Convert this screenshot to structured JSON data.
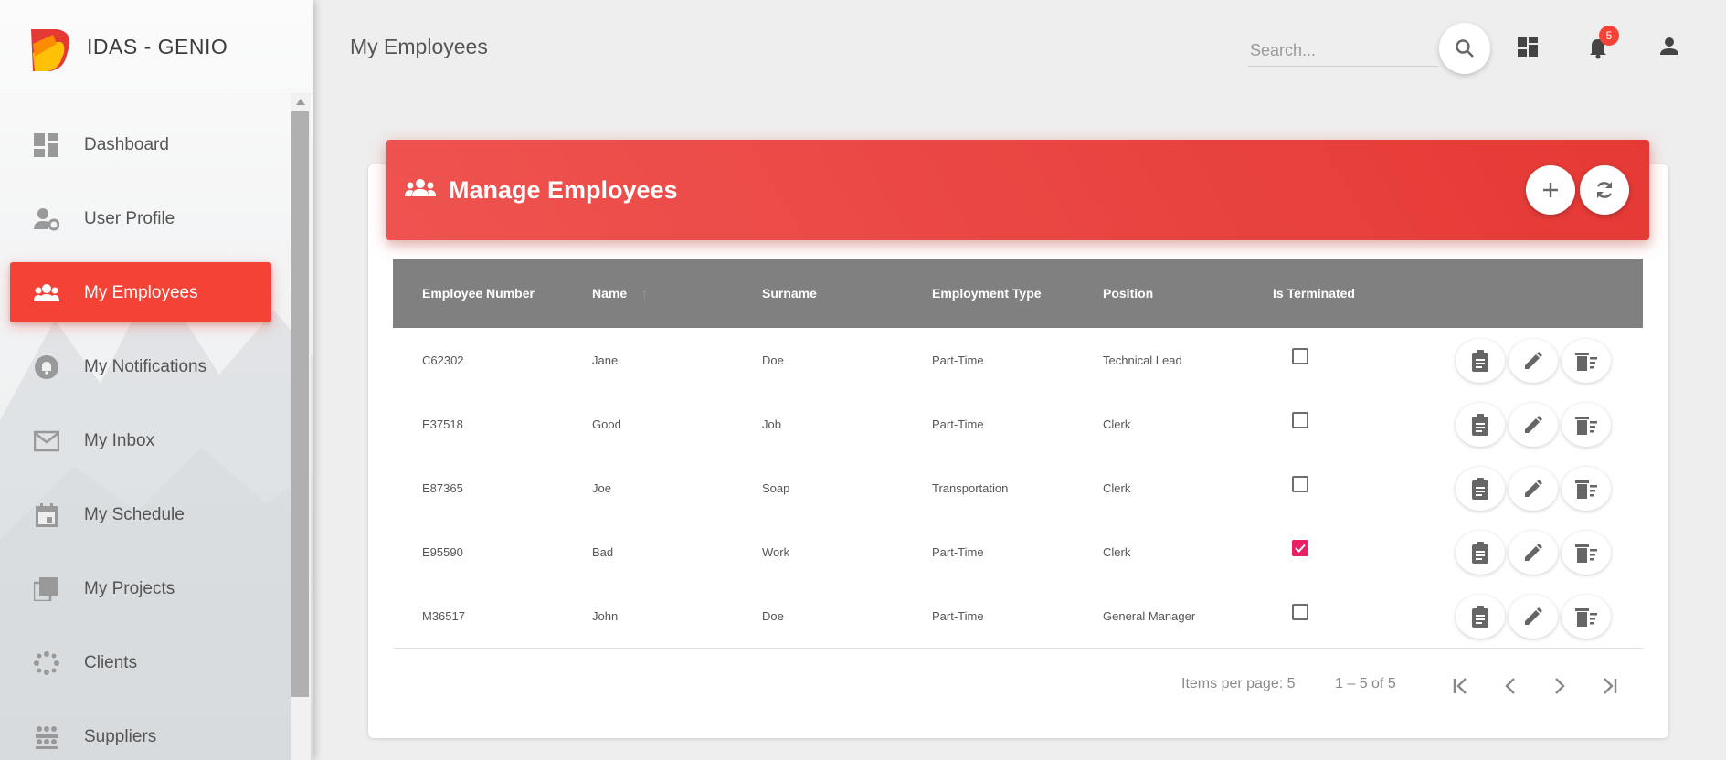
{
  "app": {
    "brand": "IDAS - GENIO"
  },
  "sidebar": {
    "items": [
      {
        "label": "Dashboard",
        "icon": "dashboard-icon",
        "active": false
      },
      {
        "label": "User Profile",
        "icon": "user-settings-icon",
        "active": false
      },
      {
        "label": "My Employees",
        "icon": "group-icon",
        "active": true
      },
      {
        "label": "My Notifications",
        "icon": "bell-icon",
        "active": false
      },
      {
        "label": "My Inbox",
        "icon": "mail-icon",
        "active": false
      },
      {
        "label": "My Schedule",
        "icon": "calendar-icon",
        "active": false
      },
      {
        "label": "My Projects",
        "icon": "library-icon",
        "active": false
      },
      {
        "label": "Clients",
        "icon": "workspaces-icon",
        "active": false
      },
      {
        "label": "Suppliers",
        "icon": "groups-icon",
        "active": false
      }
    ]
  },
  "header": {
    "title": "My Employees",
    "search_placeholder": "Search...",
    "notification_count": "5"
  },
  "card": {
    "title": "Manage Employees"
  },
  "table": {
    "columns": [
      "Employee Number",
      "Name",
      "Surname",
      "Employment Type",
      "Position",
      "Is Terminated"
    ],
    "sort_column": "Name",
    "rows": [
      {
        "employee_number": "C62302",
        "name": "Jane",
        "surname": "Doe",
        "employment_type": "Part-Time",
        "position": "Technical Lead",
        "terminated": false
      },
      {
        "employee_number": "E37518",
        "name": "Good",
        "surname": "Job",
        "employment_type": "Part-Time",
        "position": "Clerk",
        "terminated": false
      },
      {
        "employee_number": "E87365",
        "name": "Joe",
        "surname": "Soap",
        "employment_type": "Transportation",
        "position": "Clerk",
        "terminated": false
      },
      {
        "employee_number": "E95590",
        "name": "Bad",
        "surname": "Work",
        "employment_type": "Part-Time",
        "position": "Clerk",
        "terminated": true
      },
      {
        "employee_number": "M36517",
        "name": "John",
        "surname": "Doe",
        "employment_type": "Part-Time",
        "position": "General Manager",
        "terminated": false
      }
    ]
  },
  "paginator": {
    "items_per_page": "Items per page: 5",
    "range": "1 – 5 of 5"
  },
  "colors": {
    "accent": "#f44336",
    "header_gradient_start": "#ef5350",
    "header_gradient_end": "#e53935",
    "table_header": "#808080",
    "checkbox_checked": "#e91e63"
  }
}
